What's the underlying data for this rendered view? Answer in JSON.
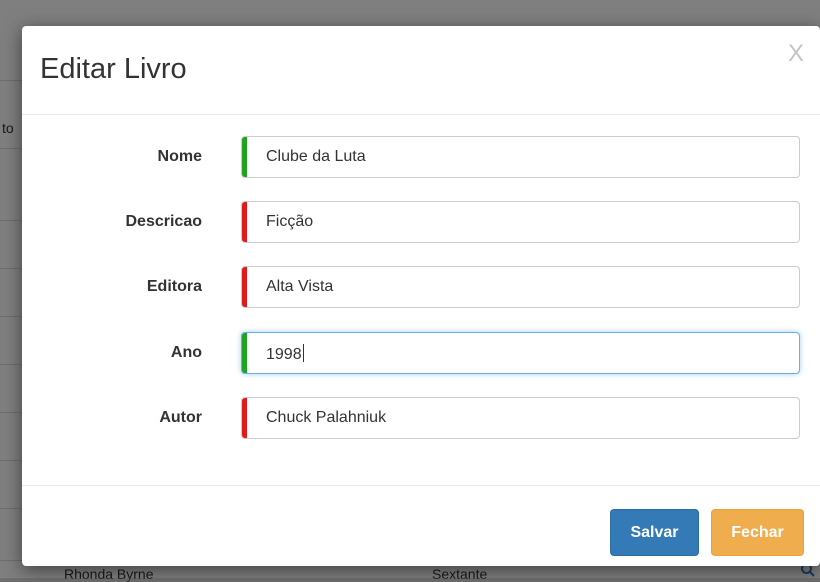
{
  "background": {
    "partial_header": "to",
    "partial_row_author": "Rhonda Byrne",
    "partial_row_publisher": "Sextante"
  },
  "modal": {
    "title": "Editar Livro",
    "close_label": "X",
    "fields": [
      {
        "label": "Nome",
        "value": "Clube da Luta",
        "status_color": "#1fa31f"
      },
      {
        "label": "Descricao",
        "value": "Ficção",
        "status_color": "#e01b1b"
      },
      {
        "label": "Editora",
        "value": "Alta Vista",
        "status_color": "#e01b1b"
      },
      {
        "label": "Ano",
        "value": "1998",
        "status_color": "#1fa31f"
      },
      {
        "label": "Autor",
        "value": "Chuck Palahniuk",
        "status_color": "#e01b1b"
      }
    ],
    "buttons": {
      "save_label": "Salvar",
      "close_label": "Fechar"
    },
    "colors": {
      "primary": "#337ab7",
      "warning": "#f0ad4e",
      "valid": "#1fa31f",
      "invalid": "#e01b1b"
    }
  }
}
